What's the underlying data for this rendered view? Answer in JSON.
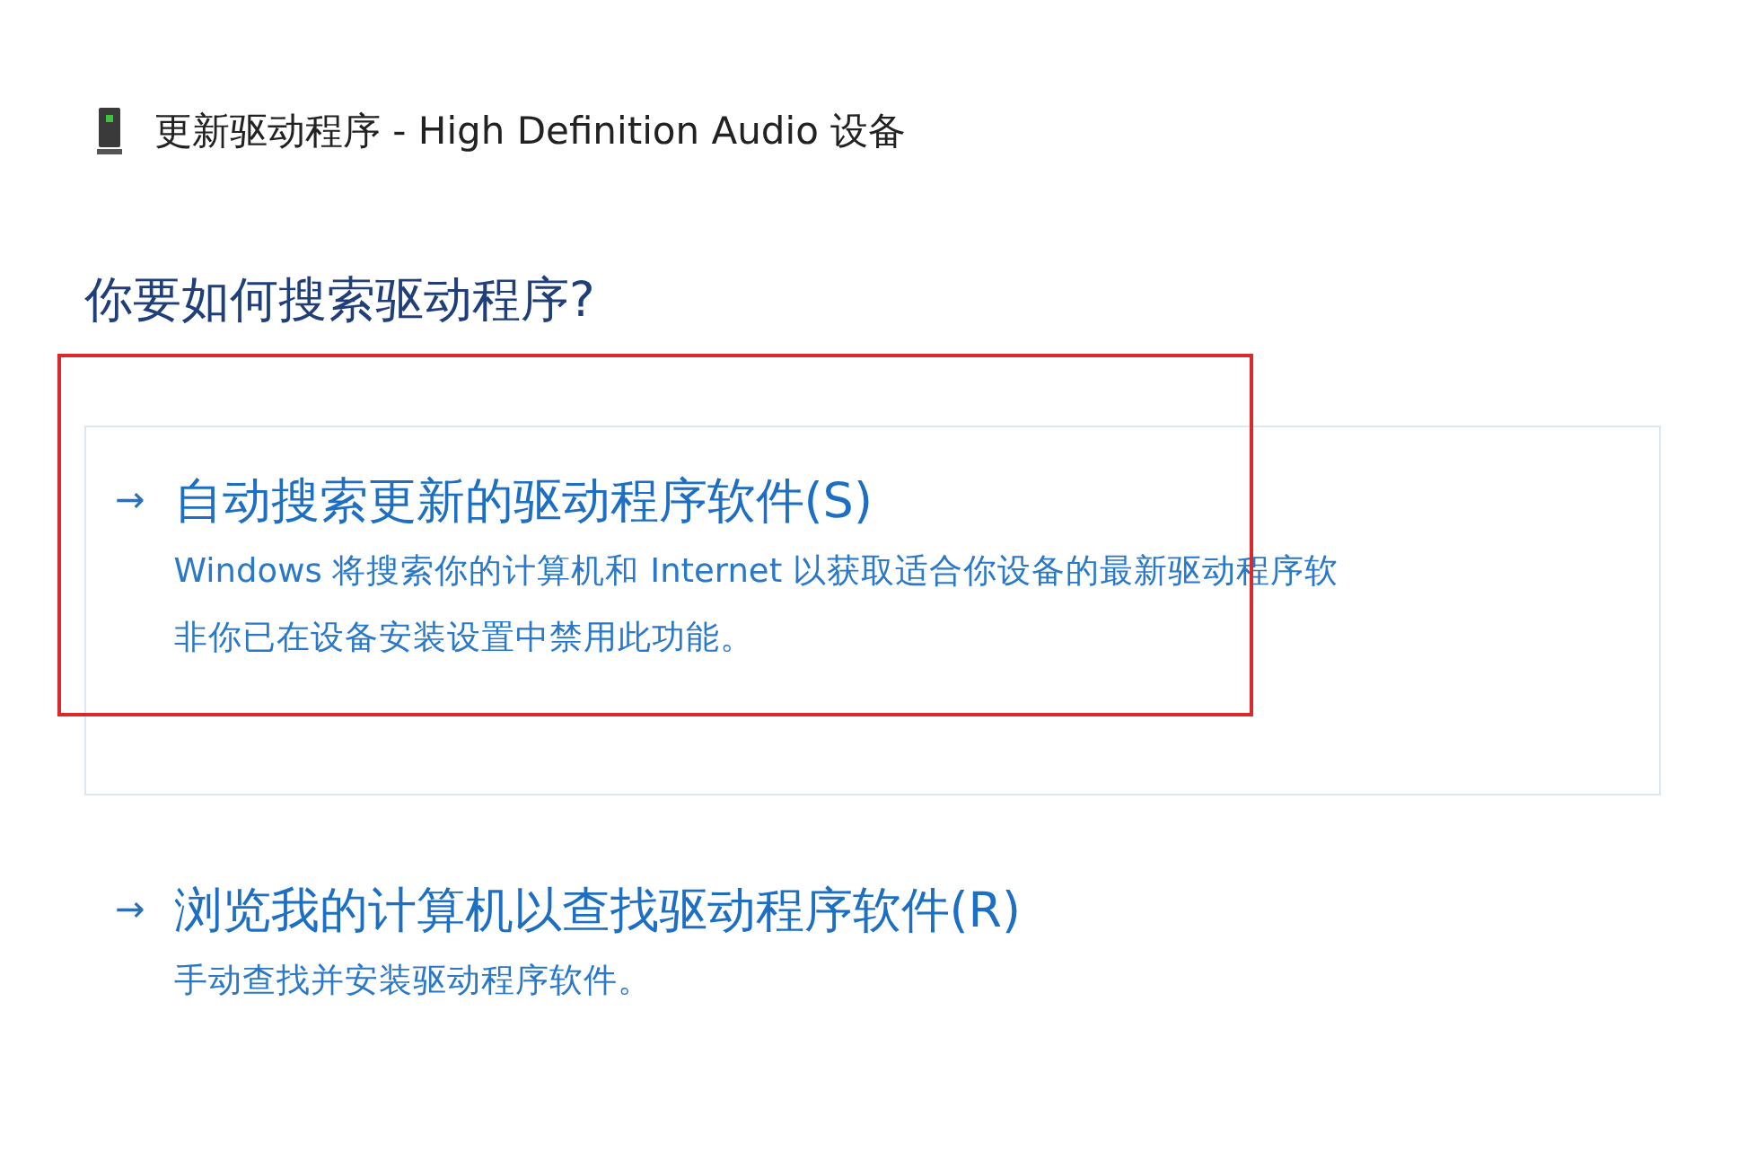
{
  "window": {
    "title": "更新驱动程序 - High Definition Audio 设备"
  },
  "heading": "你要如何搜索驱动程序?",
  "options": [
    {
      "arrow": "→",
      "title": "自动搜索更新的驱动程序软件(S)",
      "description_lines": [
        "Windows 将搜索你的计算机和 Internet 以获取适合你设备的最新驱动程序软",
        "非你已在设备安装设置中禁用此功能。"
      ],
      "focused": true,
      "highlighted": true
    },
    {
      "arrow": "→",
      "title": "浏览我的计算机以查找驱动程序软件(R)",
      "description_lines": [
        "手动查找并安装驱动程序软件。"
      ],
      "focused": false,
      "highlighted": false
    }
  ]
}
